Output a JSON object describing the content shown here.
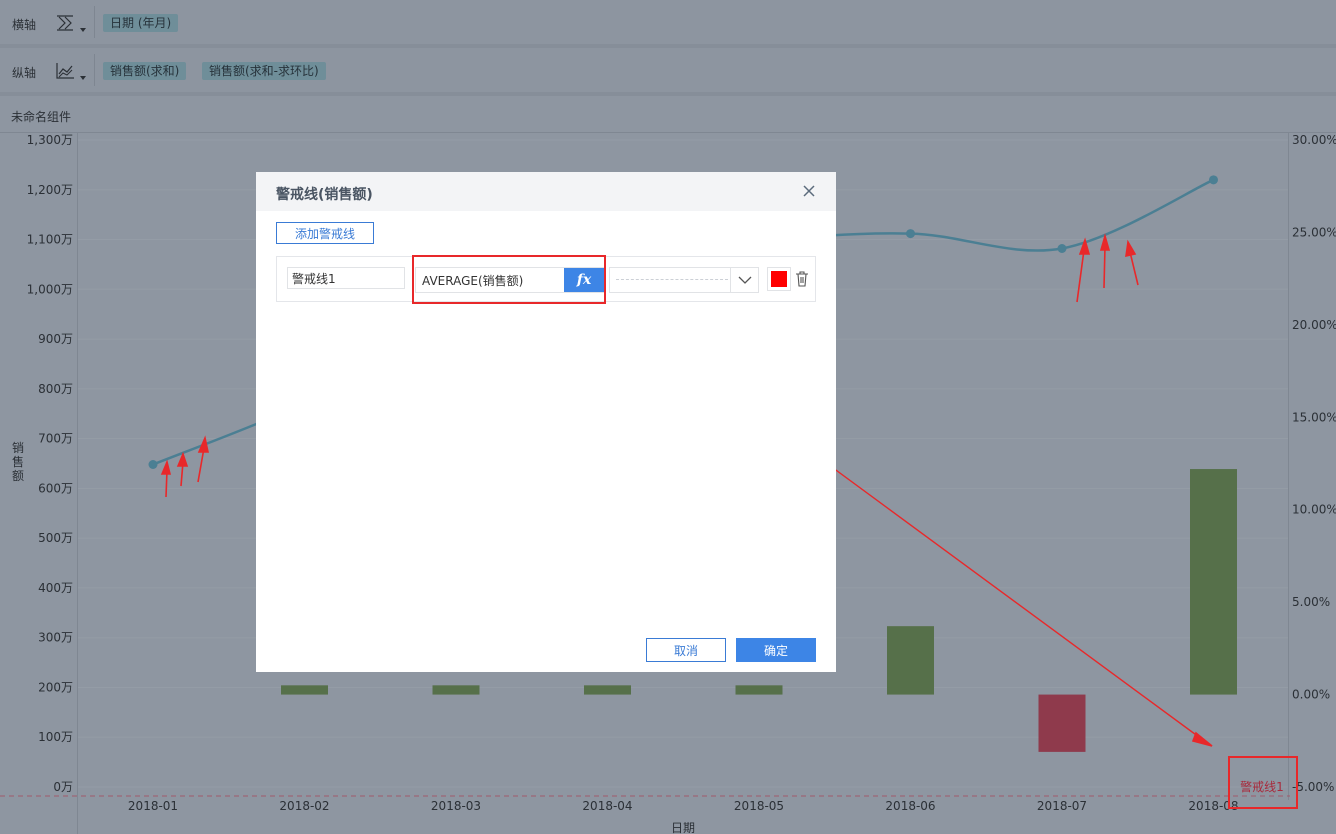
{
  "shelves": {
    "x_axis": {
      "label": "横轴",
      "icon": "chart-type-icon",
      "fields": [
        "日期 (年月)"
      ]
    },
    "y_axis": {
      "label": "纵轴",
      "icon": "line-chart-icon",
      "fields": [
        "销售额(求和)",
        "销售额(求和-求环比)"
      ]
    }
  },
  "component_title": "未命名组件",
  "chart_data": {
    "type": "bar",
    "categories": [
      "2018-01",
      "2018-02",
      "2018-03",
      "2018-04",
      "2018-05",
      "2018-06",
      "2018-07",
      "2018-08"
    ],
    "xlabel": "日期",
    "ylabel": "销售额",
    "left_axis": {
      "ticks": [
        "0万",
        "100万",
        "200万",
        "300万",
        "400万",
        "500万",
        "600万",
        "700万",
        "800万",
        "900万",
        "1,000万",
        "1,100万",
        "1,200万",
        "1,300万"
      ],
      "ylim": [
        0,
        1300
      ]
    },
    "right_axis": {
      "ticks": [
        "-5.00%",
        "0.00%",
        "5.00%",
        "10.00%",
        "15.00%",
        "20.00%",
        "25.00%",
        "30.00%"
      ],
      "ylim": [
        -5,
        30
      ]
    },
    "series": [
      {
        "name": "销售额(求和-求环比)",
        "kind": "bar",
        "axis": "right",
        "values": [
          null,
          0.5,
          0.5,
          0.5,
          0.5,
          3.7,
          -3.1,
          12.2
        ]
      },
      {
        "name": "销售额(求和)",
        "kind": "line",
        "axis": "left",
        "values": [
          648,
          770,
          920,
          1040,
          1095,
          1112,
          1082,
          1220
        ]
      }
    ],
    "bar_colors": {
      "positive": "#56704a",
      "negative": "#8f3a4c"
    },
    "line_color": "#4b7f93",
    "warning_line": {
      "label": "警戒线1",
      "color": "#c0374a"
    },
    "grid": true
  },
  "dialog": {
    "title": "警戒线(销售额)",
    "add_button": "添加警戒线",
    "rows": [
      {
        "name": "警戒线1",
        "formula": "AVERAGE(销售额)",
        "fx_label": "fx",
        "color": "#ff0000"
      }
    ],
    "cancel_label": "取消",
    "ok_label": "确定"
  },
  "colors": {
    "accent": "#3d85e6",
    "annotation": "#e8282a"
  }
}
